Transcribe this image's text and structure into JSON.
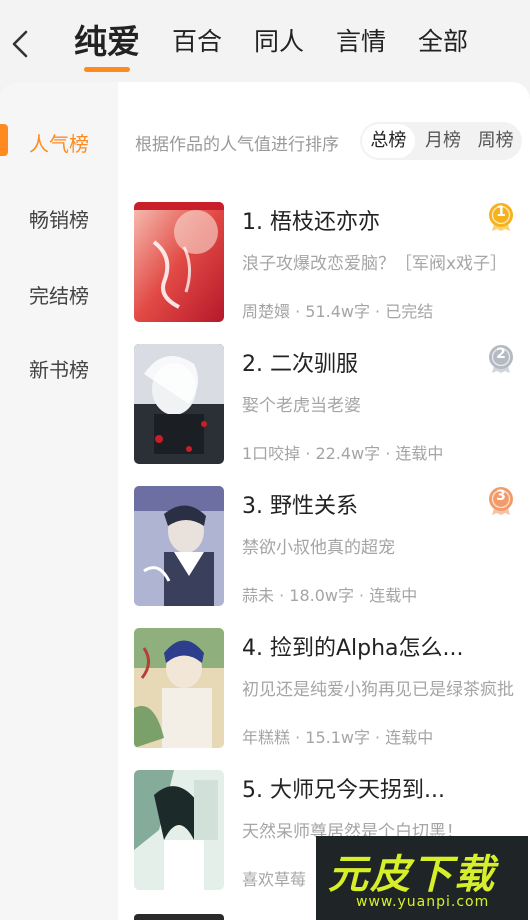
{
  "header": {
    "tabs": [
      {
        "label": "纯爱",
        "active": true
      },
      {
        "label": "百合",
        "active": false
      },
      {
        "label": "同人",
        "active": false
      },
      {
        "label": "言情",
        "active": false
      },
      {
        "label": "全部",
        "active": false
      }
    ]
  },
  "sidebar": {
    "items": [
      {
        "label": "人气榜",
        "active": true
      },
      {
        "label": "畅销榜",
        "active": false
      },
      {
        "label": "完结榜",
        "active": false
      },
      {
        "label": "新书榜",
        "active": false
      }
    ]
  },
  "main": {
    "description": "根据作品的人气值进行排序",
    "period_tabs": [
      {
        "label": "总榜",
        "active": true
      },
      {
        "label": "月榜",
        "active": false
      },
      {
        "label": "周榜",
        "active": false
      }
    ],
    "books": [
      {
        "title": "1. 梧枝还亦亦",
        "intro": "浪子攻爆改恋爱脑？［军阀x戏子］",
        "meta": "周楚嬛 · 51.4w字 · 已完结",
        "rank": "1",
        "medal_color": "#f5b21c"
      },
      {
        "title": "2. 二次驯服",
        "intro": "娶个老虎当老婆",
        "meta": "1口咬掉 · 22.4w字 · 连载中",
        "rank": "2",
        "medal_color": "#b4b9c2"
      },
      {
        "title": "3. 野性关系",
        "intro": "禁欲小叔他真的超宠",
        "meta": "蒜未 · 18.0w字 · 连载中",
        "rank": "3",
        "medal_color": "#f39a6a"
      },
      {
        "title": "4. 捡到的Alpha怎么...",
        "intro": "初见还是纯爱小狗再见已是绿茶疯批",
        "meta": "年糕糕 · 15.1w字 · 连载中"
      },
      {
        "title": "5. 大师兄今天拐到...",
        "intro": "天然呆师尊居然是个白切黑！",
        "meta": "喜欢草莓"
      }
    ]
  },
  "watermark": {
    "text": "元皮下载",
    "url": "www.yuanpi.com"
  },
  "colors": {
    "accent": "#ff8a1f"
  }
}
